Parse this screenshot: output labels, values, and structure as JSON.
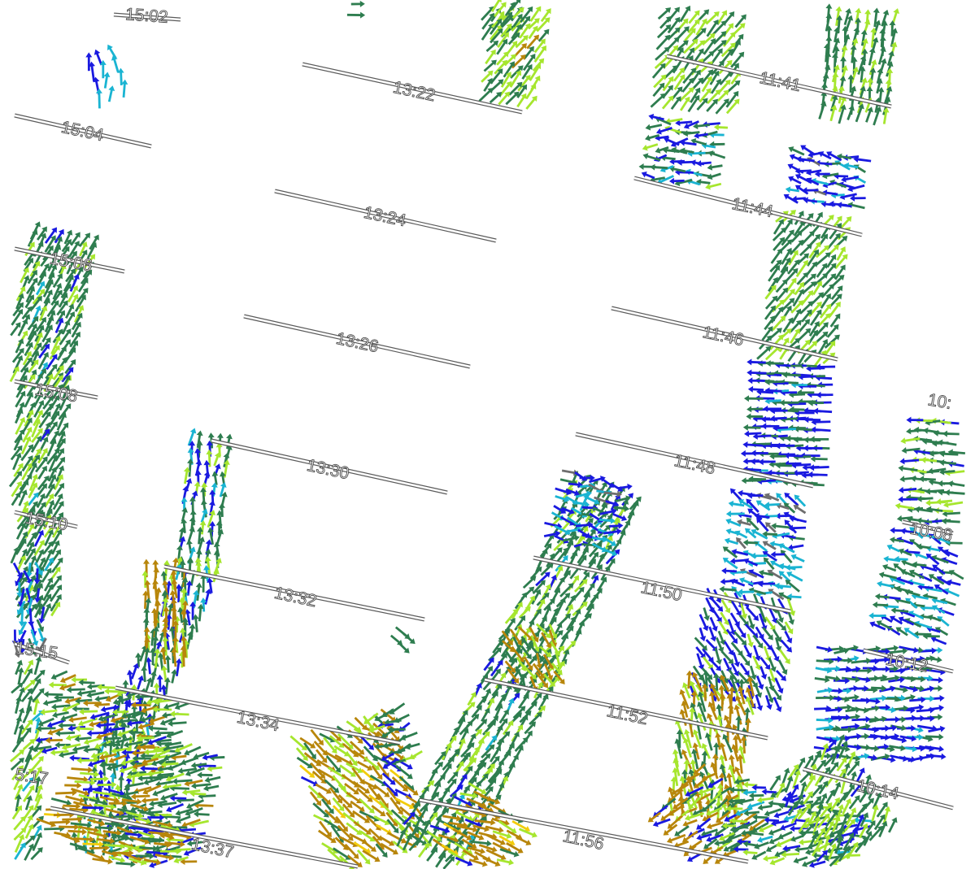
{
  "tracks": [
    {
      "id": "t1502",
      "time": "15:02"
    },
    {
      "id": "t1504",
      "time": "15:04"
    },
    {
      "id": "t1506",
      "time": "15:06"
    },
    {
      "id": "t1508",
      "time": "15:08"
    },
    {
      "id": "t1510",
      "time": "15:10"
    },
    {
      "id": "t1515",
      "time": "15:15"
    },
    {
      "id": "t1517",
      "time": "5:17"
    },
    {
      "id": "t1322",
      "time": "13:22"
    },
    {
      "id": "t1324",
      "time": "13:24"
    },
    {
      "id": "t1326",
      "time": "13:26"
    },
    {
      "id": "t1330",
      "time": "13:30"
    },
    {
      "id": "t1332",
      "time": "13:32"
    },
    {
      "id": "t1334",
      "time": "13:34"
    },
    {
      "id": "t1337",
      "time": "13:37"
    },
    {
      "id": "t1141",
      "time": "11:41"
    },
    {
      "id": "t1144",
      "time": "11:44"
    },
    {
      "id": "t1146",
      "time": "11:46"
    },
    {
      "id": "t1148",
      "time": "11:48"
    },
    {
      "id": "t1150",
      "time": "11:50"
    },
    {
      "id": "t1152",
      "time": "11:52"
    },
    {
      "id": "t1156",
      "time": "11:56"
    },
    {
      "id": "t10top",
      "time": "10:"
    },
    {
      "id": "t1008",
      "time": "10:08"
    },
    {
      "id": "t1012",
      "time": "10:12"
    },
    {
      "id": "t1014",
      "time": "10:14"
    }
  ],
  "vector_colors": {
    "blue": "#1a1ae0",
    "cyan": "#1ab4d2",
    "dark_green": "#2e7d4f",
    "light_green": "#a6e62e",
    "golden": "#b8860b",
    "yellow": "#f2cc0c",
    "gray": "#6e6e6e"
  }
}
